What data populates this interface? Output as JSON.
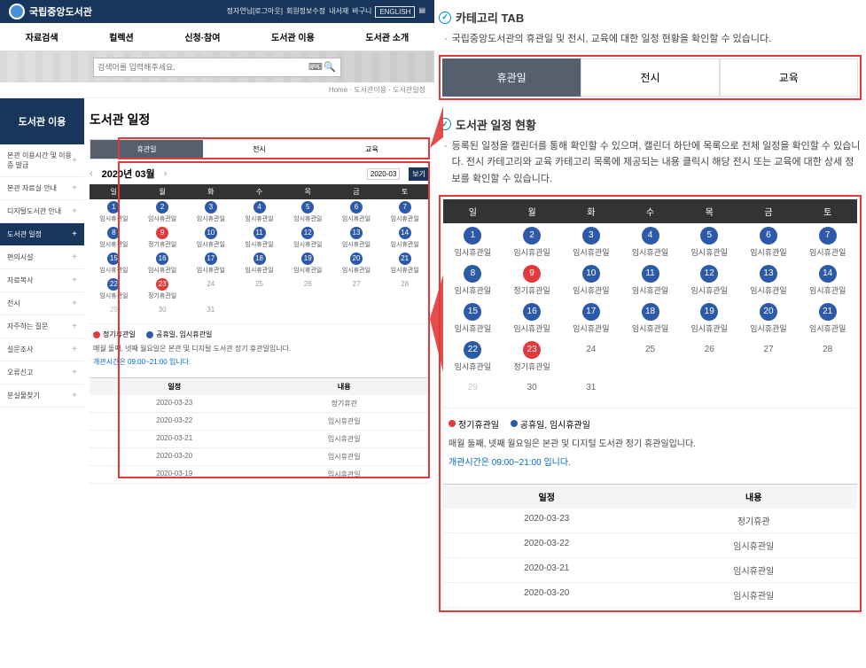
{
  "header": {
    "logo": "국립중앙도서관",
    "top_links": [
      "정자연님[로그아웃]",
      "회원정보수정",
      "내서재",
      "바구니",
      "ENGLISH"
    ],
    "nav": [
      "자료검색",
      "컬렉션",
      "신청·참여",
      "도서관 이용",
      "도서관 소개"
    ],
    "search_placeholder": "검색어를 입력해주세요."
  },
  "breadcrumb": "Home  ·  도서관이용  ·  도서관일정",
  "sidebar": {
    "title": "도서관 이용",
    "items": [
      {
        "label": "본관 이용시간 및 이용증 발급",
        "active": false
      },
      {
        "label": "본관 자료실 안내",
        "active": false
      },
      {
        "label": "디지털도서관 안내",
        "active": false
      },
      {
        "label": "도서관 일정",
        "active": true
      },
      {
        "label": "편의시설",
        "active": false
      },
      {
        "label": "자료복사",
        "active": false
      },
      {
        "label": "전시",
        "active": false
      },
      {
        "label": "자주하는 질문",
        "active": false
      },
      {
        "label": "설문조사",
        "active": false
      },
      {
        "label": "오류신고",
        "active": false
      },
      {
        "label": "분실물찾기",
        "active": false
      }
    ]
  },
  "page_title": "도서관 일정",
  "tabs": [
    "휴관일",
    "전시",
    "교육"
  ],
  "cal_title": "2020년 03월",
  "cal_select": "2020-03",
  "cal_go": "보기",
  "weekdays": [
    "일",
    "월",
    "화",
    "수",
    "목",
    "금",
    "토"
  ],
  "mini_cal": [
    [
      {
        "n": "1",
        "t": "임시휴관일",
        "c": "blue"
      },
      {
        "n": "2",
        "t": "임시휴관일",
        "c": "blue"
      },
      {
        "n": "3",
        "t": "임시휴관일",
        "c": "blue"
      },
      {
        "n": "4",
        "t": "임시휴관일",
        "c": "blue"
      },
      {
        "n": "5",
        "t": "임시휴관일",
        "c": "blue"
      },
      {
        "n": "6",
        "t": "임시휴관일",
        "c": "blue"
      },
      {
        "n": "7",
        "t": "임시휴관일",
        "c": "blue"
      }
    ],
    [
      {
        "n": "8",
        "t": "임시휴관일",
        "c": "blue"
      },
      {
        "n": "9",
        "t": "정기휴관일",
        "c": "red"
      },
      {
        "n": "10",
        "t": "임시휴관일",
        "c": "blue"
      },
      {
        "n": "11",
        "t": "임시휴관일",
        "c": "blue"
      },
      {
        "n": "12",
        "t": "임시휴관일",
        "c": "blue"
      },
      {
        "n": "13",
        "t": "임시휴관일",
        "c": "blue"
      },
      {
        "n": "14",
        "t": "임시휴관일",
        "c": "blue"
      }
    ],
    [
      {
        "n": "15",
        "t": "임시휴관일",
        "c": "blue"
      },
      {
        "n": "16",
        "t": "임시휴관일",
        "c": "blue"
      },
      {
        "n": "17",
        "t": "임시휴관일",
        "c": "blue"
      },
      {
        "n": "18",
        "t": "임시휴관일",
        "c": "blue"
      },
      {
        "n": "19",
        "t": "임시휴관일",
        "c": "blue"
      },
      {
        "n": "20",
        "t": "임시휴관일",
        "c": "blue"
      },
      {
        "n": "21",
        "t": "임시휴관일",
        "c": "blue"
      }
    ],
    [
      {
        "n": "22",
        "t": "임시휴관일",
        "c": "blue"
      },
      {
        "n": "23",
        "t": "정기휴관일",
        "c": "red"
      },
      {
        "n": "24",
        "t": "",
        "c": "gray"
      },
      {
        "n": "25",
        "t": "",
        "c": "gray"
      },
      {
        "n": "26",
        "t": "",
        "c": "gray"
      },
      {
        "n": "27",
        "t": "",
        "c": "gray"
      },
      {
        "n": "28",
        "t": "",
        "c": "gray"
      }
    ],
    [
      {
        "n": "29",
        "t": "",
        "c": "future"
      },
      {
        "n": "30",
        "t": "",
        "c": "gray"
      },
      {
        "n": "31",
        "t": "",
        "c": "gray"
      },
      {
        "n": "",
        "t": "",
        "c": ""
      },
      {
        "n": "",
        "t": "",
        "c": ""
      },
      {
        "n": "",
        "t": "",
        "c": ""
      },
      {
        "n": "",
        "t": "",
        "c": ""
      }
    ]
  ],
  "legend": {
    "regular": "정기휴관일",
    "holiday": "공휴일, 임시휴관일"
  },
  "note1": "매월 둘째, 넷째 월요일은 본관 및 디지털 도서관 정기 휴관일입니다.",
  "note2": "개관시간은 09:00~21:00 입니다.",
  "list": {
    "head": [
      "일정",
      "내용"
    ],
    "rows": [
      [
        "2020-03-23",
        "정기휴관"
      ],
      [
        "2020-03-22",
        "임시휴관일"
      ],
      [
        "2020-03-21",
        "임시휴관일"
      ],
      [
        "2020-03-20",
        "임시휴관일"
      ],
      [
        "2020-03-19",
        "임시휴관일"
      ]
    ]
  },
  "help": {
    "s1_title": "카테고리 TAB",
    "s1_body": "국립중앙도서관의 휴관일 및 전시, 교육에 대한 일정 현황을 확인할 수 있습니다.",
    "s2_title": "도서관 일정 현황",
    "s2_body": "등록된 일정을 캘린더를 통해 확인할 수 있으며, 캘린더 하단에 목록으로 전체 일정을 확인할 수 있습니다. 전시 카테고리와 교육 카테고리 목록에 제공되는 내용 클릭시 해당 전시 또는 교육에 대한 상세 정보를 확인할 수 있습니다."
  },
  "big_cal": [
    [
      {
        "n": "1",
        "t": "임시휴관일",
        "c": "blue"
      },
      {
        "n": "2",
        "t": "임시휴관일",
        "c": "blue"
      },
      {
        "n": "3",
        "t": "임시휴관일",
        "c": "blue"
      },
      {
        "n": "4",
        "t": "임시휴관일",
        "c": "blue"
      },
      {
        "n": "5",
        "t": "임시휴관일",
        "c": "blue"
      },
      {
        "n": "6",
        "t": "임시휴관일",
        "c": "blue"
      },
      {
        "n": "7",
        "t": "임시휴관일",
        "c": "blue"
      }
    ],
    [
      {
        "n": "8",
        "t": "임시휴관일",
        "c": "blue"
      },
      {
        "n": "9",
        "t": "정기휴관일",
        "c": "red"
      },
      {
        "n": "10",
        "t": "임시휴관일",
        "c": "blue"
      },
      {
        "n": "11",
        "t": "임시휴관일",
        "c": "blue"
      },
      {
        "n": "12",
        "t": "임시휴관일",
        "c": "blue"
      },
      {
        "n": "13",
        "t": "임시휴관일",
        "c": "blue"
      },
      {
        "n": "14",
        "t": "임시휴관일",
        "c": "blue"
      }
    ],
    [
      {
        "n": "15",
        "t": "임시휴관일",
        "c": "blue"
      },
      {
        "n": "16",
        "t": "임시휴관일",
        "c": "blue"
      },
      {
        "n": "17",
        "t": "임시휴관일",
        "c": "blue"
      },
      {
        "n": "18",
        "t": "임시휴관일",
        "c": "blue"
      },
      {
        "n": "19",
        "t": "임시휴관일",
        "c": "blue"
      },
      {
        "n": "20",
        "t": "임시휴관일",
        "c": "blue"
      },
      {
        "n": "21",
        "t": "임시휴관일",
        "c": "blue"
      }
    ],
    [
      {
        "n": "22",
        "t": "임시휴관일",
        "c": "blue"
      },
      {
        "n": "23",
        "t": "정기휴관일",
        "c": "red"
      },
      {
        "n": "24",
        "t": "",
        "c": "plain"
      },
      {
        "n": "25",
        "t": "",
        "c": "plain"
      },
      {
        "n": "26",
        "t": "",
        "c": "plain"
      },
      {
        "n": "27",
        "t": "",
        "c": "plain"
      },
      {
        "n": "28",
        "t": "",
        "c": "plain"
      }
    ],
    [
      {
        "n": "29",
        "t": "",
        "c": "dim"
      },
      {
        "n": "30",
        "t": "",
        "c": "plain"
      },
      {
        "n": "31",
        "t": "",
        "c": "plain"
      },
      {
        "n": "",
        "t": "",
        "c": ""
      },
      {
        "n": "",
        "t": "",
        "c": ""
      },
      {
        "n": "",
        "t": "",
        "c": ""
      },
      {
        "n": "",
        "t": "",
        "c": ""
      }
    ]
  ],
  "big_list_rows": [
    [
      "2020-03-23",
      "정기휴관"
    ],
    [
      "2020-03-22",
      "임시휴관일"
    ],
    [
      "2020-03-21",
      "임시휴관일"
    ],
    [
      "2020-03-20",
      "임시휴관일"
    ]
  ]
}
